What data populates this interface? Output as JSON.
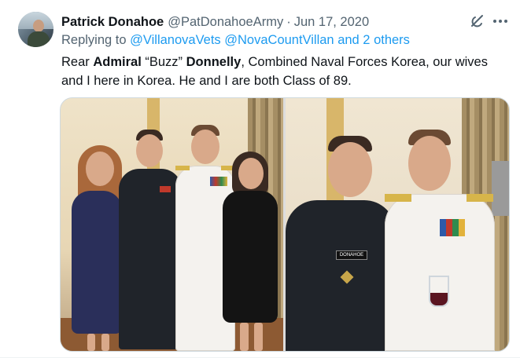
{
  "tweet": {
    "author_name": "Patrick Donahoe",
    "handle": "@PatDonahoeArmy",
    "separator": "·",
    "date": "Jun 17, 2020",
    "reply_prefix": "Replying to",
    "reply_targets": "@VillanovaVets @NovaCountVillan and 2 others",
    "text": {
      "part1": "Rear ",
      "bold1": "Admiral",
      "part2": " “Buzz” ",
      "bold2": "Donnelly",
      "part3": ", Combined Naval Forces Korea, our wives and I here in Korea. He and I are both Class of 89."
    }
  },
  "icons": {
    "grok": "grok-icon",
    "more": "more-options-icon"
  },
  "colors": {
    "link": "#1d9bf0",
    "secondary_text": "#536471",
    "primary_text": "#0f1419"
  },
  "media": {
    "name_tag": "DONAHOE"
  }
}
